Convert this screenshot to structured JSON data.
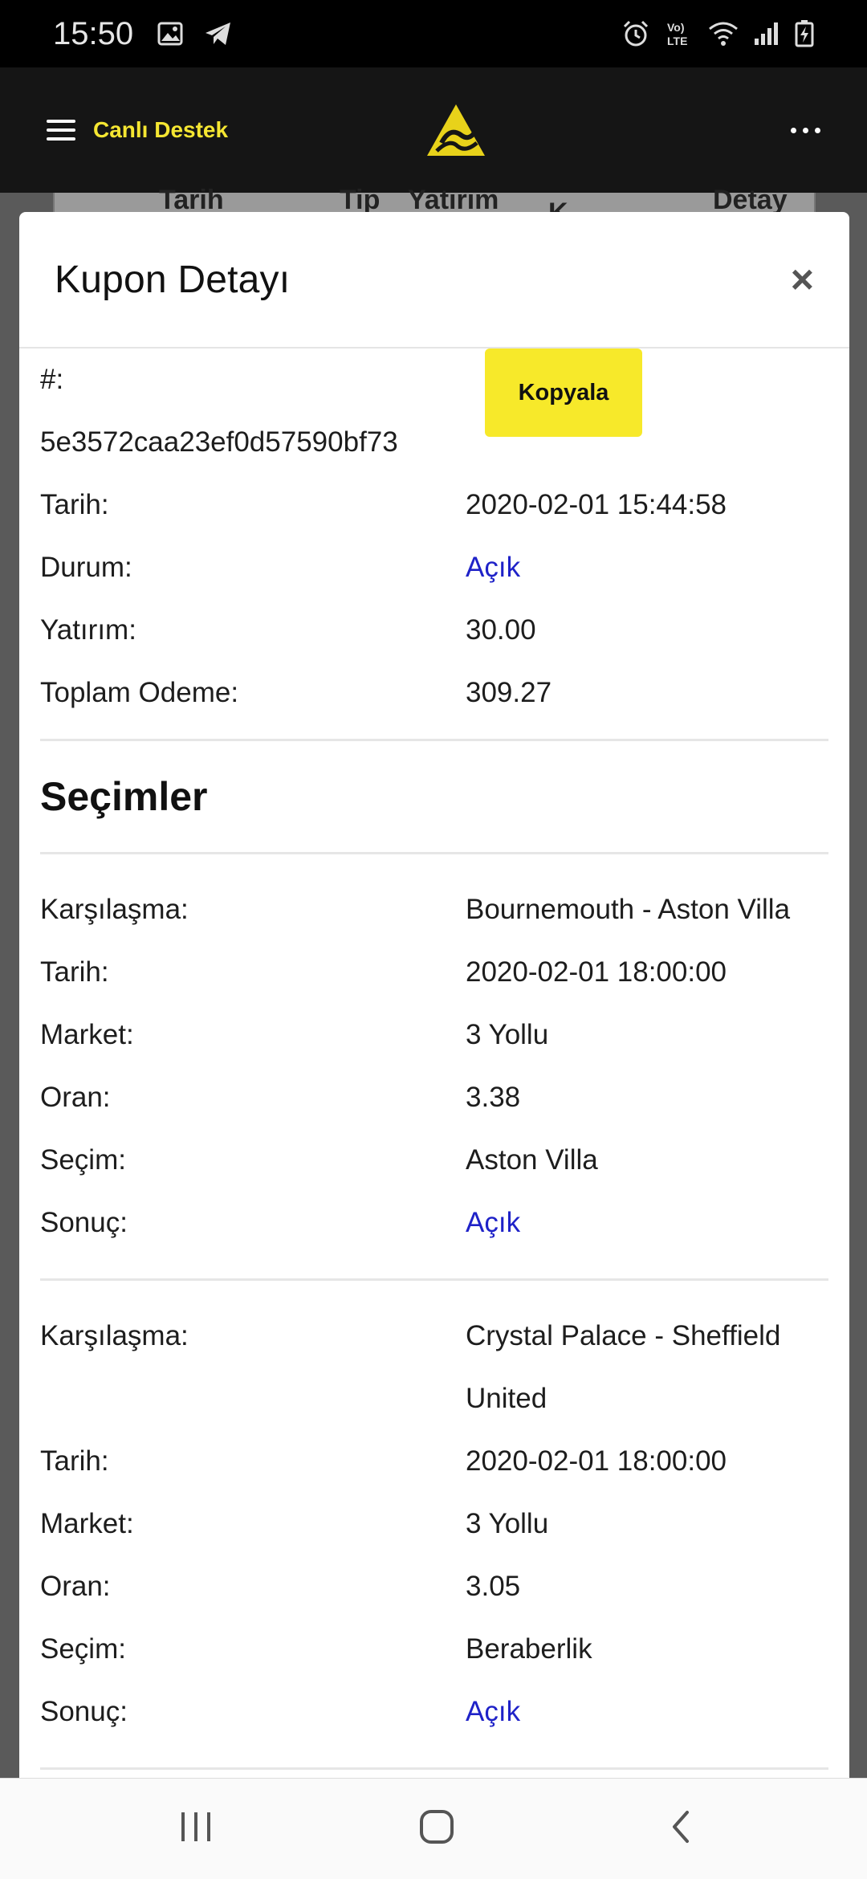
{
  "status_bar": {
    "time": "15:50",
    "icons": [
      "image-icon",
      "telegram-icon",
      "alarm-icon",
      "volte-icon",
      "wifi-icon",
      "signal-icon",
      "battery-icon"
    ]
  },
  "header": {
    "support_label": "Canlı Destek",
    "logo": "brand-logo"
  },
  "background_table": {
    "headers": [
      "Tarih",
      "Tip",
      "Yatırım",
      "K",
      "Detay"
    ]
  },
  "modal": {
    "title": "Kupon Detayı",
    "close_symbol": "×",
    "copy_label": "Kopyala",
    "hash_label": "#:",
    "hash_value": "5e3572caa23ef0d57590bf73",
    "summary": [
      {
        "label": "Tarih:",
        "value": "2020-02-01 15:44:58"
      },
      {
        "label": "Durum:",
        "value": "Açık"
      },
      {
        "label": "Yatırım:",
        "value": "30.00"
      },
      {
        "label": "Toplam Odeme:",
        "value": "309.27"
      }
    ],
    "selections_title": "Seçimler",
    "selections": [
      {
        "match_label": "Karşılaşma:",
        "match": "Bournemouth - Aston Villa",
        "date_label": "Tarih:",
        "date": "2020-02-01 18:00:00",
        "market_label": "Market:",
        "market": "3 Yollu",
        "odds_label": "Oran:",
        "odds": "3.38",
        "pick_label": "Seçim:",
        "pick": "Aston Villa",
        "result_label": "Sonuç:",
        "result": "Açık"
      },
      {
        "match_label": "Karşılaşma:",
        "match": "Crystal Palace - Sheffield",
        "match_line2": "United",
        "date_label": "Tarih:",
        "date": "2020-02-01 18:00:00",
        "market_label": "Market:",
        "market": "3 Yollu",
        "odds_label": "Oran:",
        "odds": "3.05",
        "pick_label": "Seçim:",
        "pick": "Beraberlik",
        "result_label": "Sonuç:",
        "result": "Açık"
      }
    ]
  },
  "colors": {
    "accent_yellow": "#f7e92a",
    "link_blue": "#1f22c8",
    "header_bg": "#151515"
  }
}
